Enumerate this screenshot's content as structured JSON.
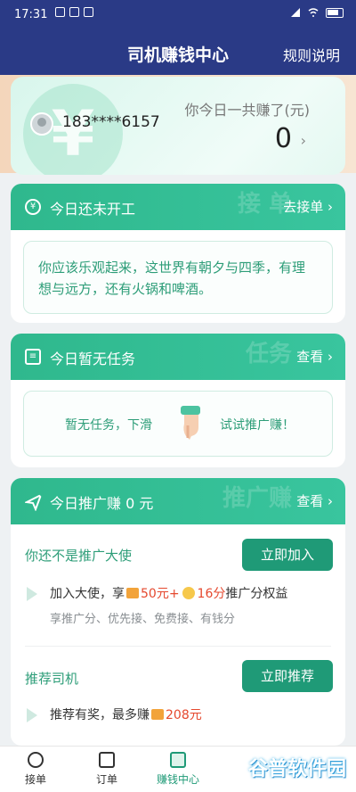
{
  "status": {
    "time": "17:31"
  },
  "nav": {
    "title": "司机赚钱中心",
    "rules": "规则说明"
  },
  "hero": {
    "coin_glyph": "¥",
    "phone": "183****6157",
    "earn_label": "你今日一共赚了(元)",
    "earn_value": "0",
    "arrow": "›"
  },
  "work": {
    "title": "今日还未开工",
    "action": "去接单 ›",
    "watermark": "接 单",
    "quote": "你应该乐观起来，这世界有朝夕与四季，有理想与远方，还有火锅和啤酒。"
  },
  "tasks": {
    "title": "今日暂无任务",
    "action": "查看 ›",
    "watermark": "任务",
    "left_text": "暂无任务，下滑",
    "right_text": "试试推广赚！"
  },
  "promo": {
    "title": "今日推广赚 0 元",
    "action": "查看 ›",
    "watermark": "推广赚",
    "ambassador_title": "你还不是推广大使",
    "join_button": "立即加入",
    "join_prefix": "加入大使，享",
    "join_amount": "50元+",
    "join_points": "16分",
    "join_suffix": "推广分权益",
    "join_sub": "享推广分、优先接、免费接、有钱分",
    "recommend_title": "推荐司机",
    "recommend_button": "立即推荐",
    "recommend_prefix": "推荐有奖，最多赚",
    "recommend_amount": "208元"
  },
  "tabs": [
    {
      "label": "接单"
    },
    {
      "label": "订单"
    },
    {
      "label": "赚钱中心"
    }
  ],
  "watermark_brand": "谷普软件园",
  "colors": {
    "nav": "#2a3a86",
    "accent": "#1f9a77",
    "red": "#e5482e"
  }
}
